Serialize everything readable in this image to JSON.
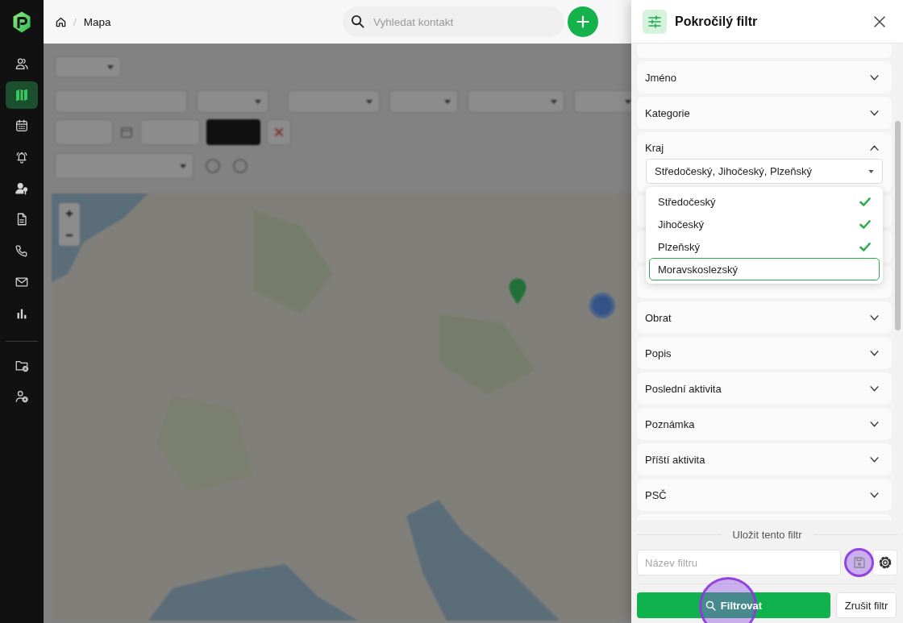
{
  "sidebar": {
    "items": [
      {
        "kind": "people",
        "selected": false
      },
      {
        "kind": "map",
        "selected": true
      },
      {
        "kind": "calendar",
        "selected": false
      },
      {
        "kind": "bell",
        "selected": false
      },
      {
        "kind": "keyuser",
        "selected": false
      },
      {
        "kind": "document",
        "selected": false
      },
      {
        "kind": "phone",
        "selected": false
      },
      {
        "kind": "mail",
        "selected": false
      },
      {
        "kind": "chart",
        "selected": false
      }
    ],
    "bottom_items": [
      {
        "kind": "folder",
        "selected": false
      },
      {
        "kind": "usersettings",
        "selected": false
      }
    ]
  },
  "topbar": {
    "breadcrumb": {
      "separator": "/",
      "current": "Mapa"
    },
    "search": {
      "placeholder": "Vyhledat kontakt"
    }
  },
  "panel": {
    "title": "Pokročilý filtr",
    "filters": [
      {
        "kind": "cut"
      },
      {
        "kind": "field",
        "label": "Jméno",
        "expanded": false
      },
      {
        "kind": "field",
        "label": "Kategorie",
        "expanded": false
      },
      {
        "kind": "field",
        "label": "Kraj",
        "expanded": true,
        "select": {
          "value": "Středočeský, Jihočeský, Plzeňský",
          "open": true,
          "options": [
            {
              "label": "Středočeský",
              "selected": true,
              "highlighted": false
            },
            {
              "label": "Jihočeský",
              "selected": true,
              "highlighted": false
            },
            {
              "label": "Plzeňský",
              "selected": true,
              "highlighted": false
            },
            {
              "label": "Moravskoslezský",
              "selected": false,
              "highlighted": true
            }
          ]
        }
      },
      {
        "kind": "covered"
      },
      {
        "kind": "covered"
      },
      {
        "kind": "covered"
      },
      {
        "kind": "field",
        "label": "Obrat",
        "expanded": false
      },
      {
        "kind": "field",
        "label": "Popis",
        "expanded": false
      },
      {
        "kind": "field",
        "label": "Poslední aktivita",
        "expanded": false
      },
      {
        "kind": "field",
        "label": "Poznámka",
        "expanded": false
      },
      {
        "kind": "field",
        "label": "Příští aktivita",
        "expanded": false
      },
      {
        "kind": "field",
        "label": "PSČ",
        "expanded": false
      },
      {
        "kind": "cut"
      }
    ],
    "save": {
      "heading": "Uložit tento filtr",
      "name_field": {
        "placeholder": "Název filtru"
      },
      "save_button": {
        "click_indicator": true
      }
    },
    "buttons": {
      "apply": {
        "label": "Filtrovat",
        "click_indicator": true
      },
      "cancel": {
        "label": "Zrušit filtr"
      }
    }
  }
}
